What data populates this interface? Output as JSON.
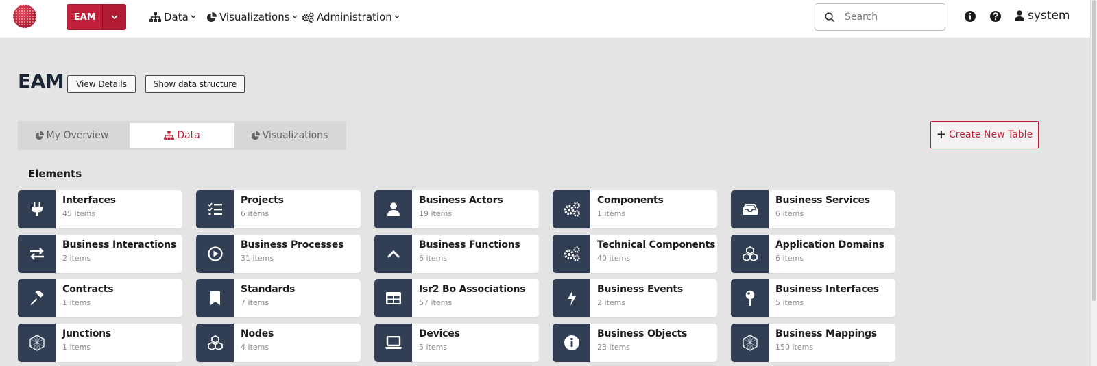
{
  "app": {
    "button_label": "EAM"
  },
  "nav": [
    {
      "label": "Data",
      "icon": "sitemap-icon"
    },
    {
      "label": "Visualizations",
      "icon": "pie-chart-icon"
    },
    {
      "label": "Administration",
      "icon": "cogs-icon"
    }
  ],
  "search": {
    "placeholder": "Search"
  },
  "user": {
    "name": "system"
  },
  "page": {
    "title": "EAM",
    "view_details": "View Details",
    "show_structure": "Show data structure"
  },
  "tabs": [
    {
      "label": "My Overview",
      "icon": "pie-chart-icon",
      "active": false
    },
    {
      "label": "Data",
      "icon": "sitemap-icon",
      "active": true
    },
    {
      "label": "Visualizations",
      "icon": "pie-chart-icon",
      "active": false
    }
  ],
  "create_table": "Create New Table",
  "section": "Elements",
  "elements": [
    {
      "name": "Interfaces",
      "count": "45 items",
      "icon": "plug-icon"
    },
    {
      "name": "Projects",
      "count": "6 items",
      "icon": "tasks-icon"
    },
    {
      "name": "Business Actors",
      "count": "19 items",
      "icon": "user-icon"
    },
    {
      "name": "Components",
      "count": "1 items",
      "icon": "cogs-icon"
    },
    {
      "name": "Business Services",
      "count": "6 items",
      "icon": "inbox-icon"
    },
    {
      "name": "Business Interactions",
      "count": "2 items",
      "icon": "exchange-icon"
    },
    {
      "name": "Business Processes",
      "count": "31 items",
      "icon": "play-circle-icon"
    },
    {
      "name": "Business Functions",
      "count": "6 items",
      "icon": "chevron-up-icon"
    },
    {
      "name": "Technical Components",
      "count": "40 items",
      "icon": "cogs-icon"
    },
    {
      "name": "Application Domains",
      "count": "6 items",
      "icon": "cubes-icon"
    },
    {
      "name": "Contracts",
      "count": "1 items",
      "icon": "gavel-icon"
    },
    {
      "name": "Standards",
      "count": "7 items",
      "icon": "bookmark-icon"
    },
    {
      "name": "Isr2 Bo Associations",
      "count": "57 items",
      "icon": "table-icon"
    },
    {
      "name": "Business Events",
      "count": "2 items",
      "icon": "bolt-icon"
    },
    {
      "name": "Business Interfaces",
      "count": "5 items",
      "icon": "pin-icon"
    },
    {
      "name": "Junctions",
      "count": "1 items",
      "icon": "hexagon-icon"
    },
    {
      "name": "Nodes",
      "count": "4 items",
      "icon": "cubes-icon"
    },
    {
      "name": "Devices",
      "count": "5 items",
      "icon": "laptop-icon"
    },
    {
      "name": "Business Objects",
      "count": "23 items",
      "icon": "info-circle-icon"
    },
    {
      "name": "Business Mappings",
      "count": "150 items",
      "icon": "hexagon-icon"
    }
  ],
  "colors": {
    "accent": "#c0203a",
    "tile": "#323e54",
    "background": "#e5e4e5"
  }
}
